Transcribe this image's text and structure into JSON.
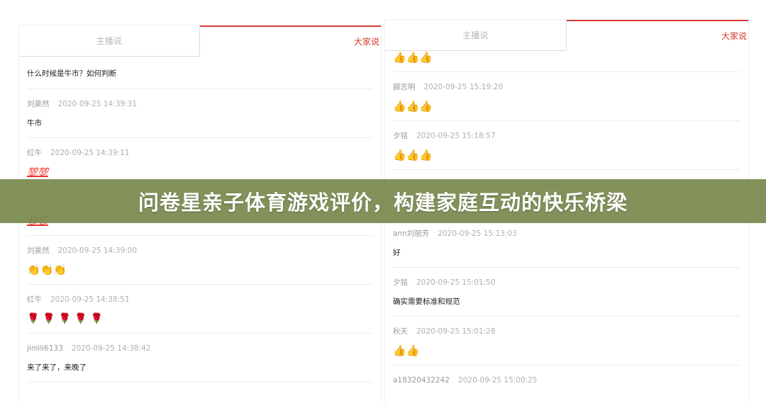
{
  "banner": {
    "title": "问卷星亲子体育游戏评价，构建家庭互动的快乐桥梁"
  },
  "left_panel": {
    "tabs": [
      {
        "label": "主播说"
      },
      {
        "label": "大家说"
      }
    ],
    "question": "什么时候是牛市？如何判断",
    "comments": [
      {
        "user": "刘昊然",
        "time": "2020-09-25 14:39:31",
        "text": "牛市"
      },
      {
        "user": "红牛",
        "time": "2020-09-25 14:39:11",
        "text": "💯💯"
      },
      {
        "user": "",
        "time": "",
        "text": "💯💯"
      },
      {
        "user": "刘昊然",
        "time": "2020-09-25 14:39:00",
        "text": "👏👏👏"
      },
      {
        "user": "红牛",
        "time": "2020-09-25 14:38:51",
        "text": "🌹🌹🌹🌹🌹"
      },
      {
        "user": "jinlili6133",
        "time": "2020-09-25 14:38:42",
        "text": "来了来了，来晚了"
      }
    ]
  },
  "right_panel": {
    "tabs": [
      {
        "label": "主播说"
      },
      {
        "label": "大家说"
      }
    ],
    "comments": [
      {
        "user": "",
        "time": "",
        "text": "👍👍👍"
      },
      {
        "user": "郦志明",
        "time": "2020-09-25 15:19:20",
        "text": "👍👍👍"
      },
      {
        "user": "夕铭",
        "time": "2020-09-25 15:18:57",
        "text": "👍👍👍"
      },
      {
        "user": "",
        "time": "",
        "text": ""
      },
      {
        "user": "ann刘丽芳",
        "time": "2020-09-25 15:13:03",
        "text": "好"
      },
      {
        "user": "夕铭",
        "time": "2020-09-25 15:01:50",
        "text": "确实需要标准和规范"
      },
      {
        "user": "秋天",
        "time": "2020-09-25 15:01:28",
        "text": "👍👍"
      },
      {
        "user": "a18320432242",
        "time": "2020-09-25 15:00:25",
        "text": ""
      }
    ]
  }
}
